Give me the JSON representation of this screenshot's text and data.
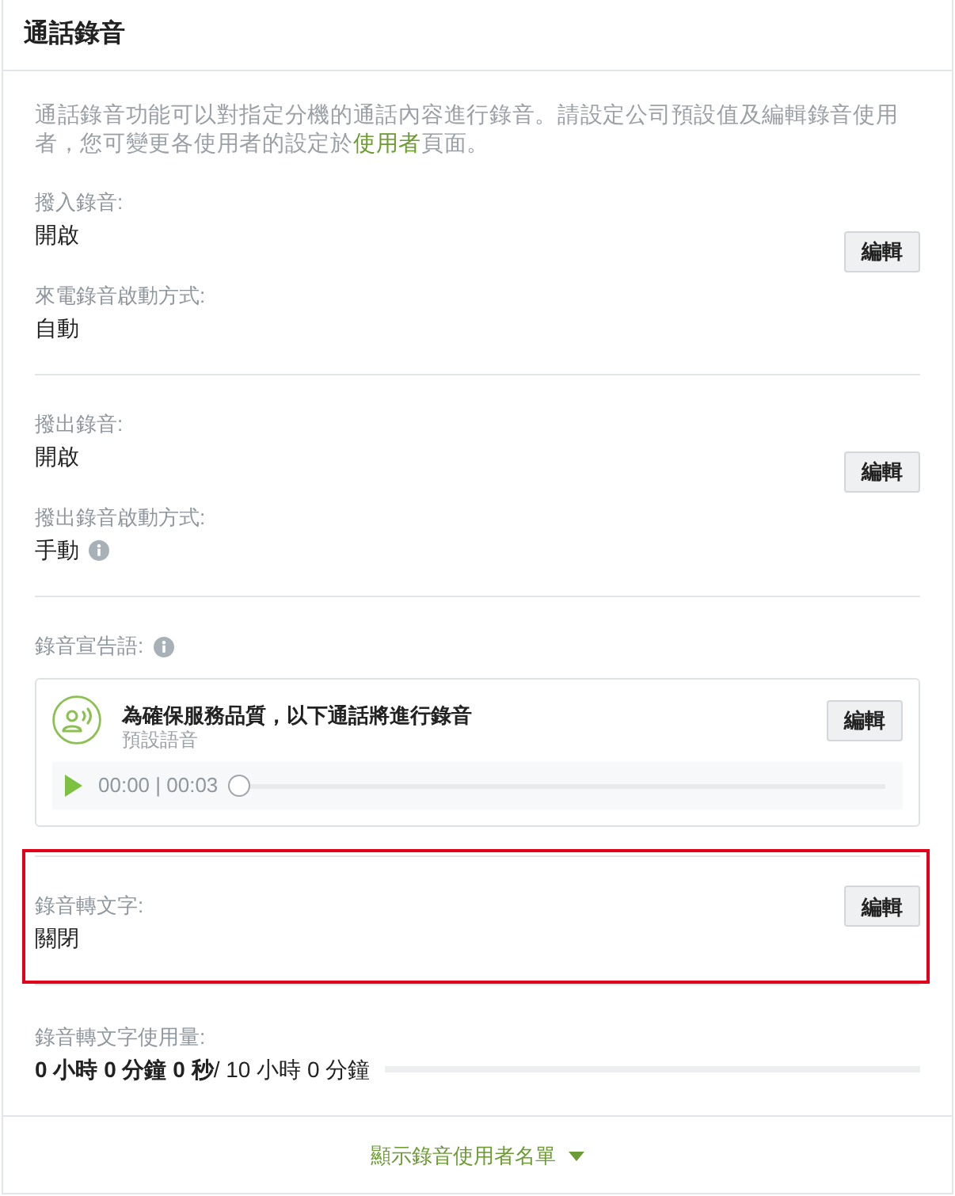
{
  "panel": {
    "title": "通話錄音"
  },
  "description": {
    "text_before": "通話錄音功能可以對指定分機的通話內容進行錄音。請設定公司預設值及編輯錄音使用者，您可變更各使用者的設定於",
    "link": "使用者",
    "text_after": "頁面。"
  },
  "sections": [
    {
      "kind": "settings",
      "highlighted": false,
      "fields": [
        {
          "label": "撥入錄音:",
          "value": "開啟",
          "info": false
        },
        {
          "label": "來電錄音啟動方式:",
          "value": "自動",
          "info": false
        }
      ],
      "button": "編輯"
    },
    {
      "kind": "settings",
      "highlighted": false,
      "fields": [
        {
          "label": "撥出錄音:",
          "value": "開啟",
          "info": false
        },
        {
          "label": "撥出錄音啟動方式:",
          "value": "手動",
          "info": true
        }
      ],
      "button": "編輯"
    },
    {
      "kind": "announcement",
      "highlighted": false,
      "label": "錄音宣告語:",
      "info": true,
      "card": {
        "title": "為確保服務品質，以下通話將進行錄音",
        "subtitle": "預設語音",
        "button": "編輯",
        "player": {
          "time": "00:00 | 00:03",
          "level": 0
        }
      }
    },
    {
      "kind": "settings",
      "highlighted": true,
      "fields": [
        {
          "label": "錄音轉文字:",
          "value": "關閉",
          "info": false
        }
      ],
      "button": "編輯"
    },
    {
      "kind": "usage",
      "highlighted": false,
      "label": "錄音轉文字使用量:",
      "reading": "**0 小時 0 分鐘 0 秒**/ 10 小時 0 分鐘",
      "level": 0
    }
  ],
  "footer": {
    "toggle": "顯示錄音使用者名單",
    "expanded": false
  }
}
